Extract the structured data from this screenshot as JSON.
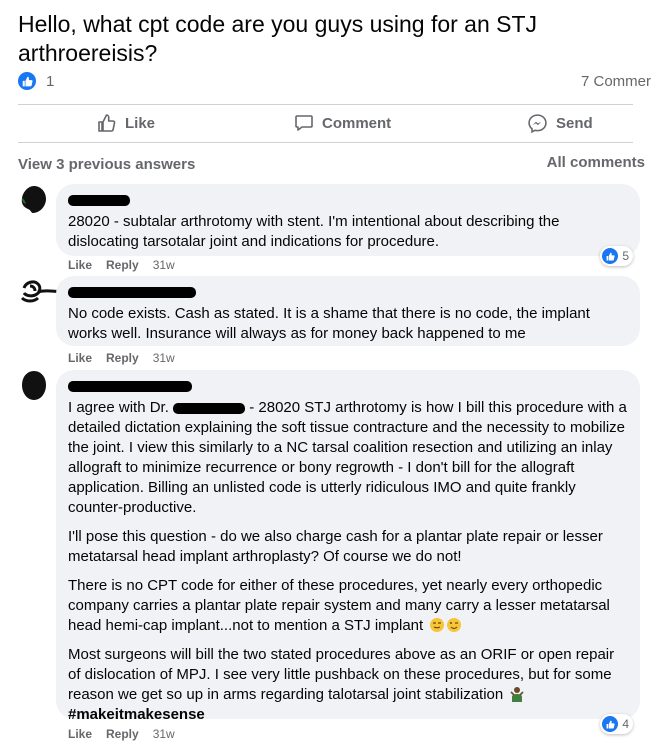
{
  "post": {
    "title": "Hello, what cpt code are you guys using for an STJ arthroereisis?",
    "reaction_count": "1",
    "comment_count": "7 Commer"
  },
  "actions": {
    "like": "Like",
    "comment": "Comment",
    "send": "Send"
  },
  "comments_header": {
    "view_previous": "View 3 previous answers",
    "sort": "All comments"
  },
  "colors": {
    "accent": "#1877f2",
    "bubble": "#f0f2f5",
    "muted": "#65676b"
  },
  "comments": [
    {
      "text": "28020 - subtalar arthrotomy with stent. I'm intentional about describing the dislocating tarsotalar joint and indications for procedure.",
      "like": "Like",
      "reply": "Reply",
      "time": "31w",
      "reactions": "5"
    },
    {
      "text": "No code exists. Cash as stated. It is a shame that there is no code, the implant works well. Insurance will always as for money back happened to me",
      "like": "Like",
      "reply": "Reply",
      "time": "31w"
    },
    {
      "para1_start": "I agree with Dr.",
      "para1_rest": " - 28020 STJ arthrotomy is how I bill this procedure with a detailed dictation explaining the soft tissue contracture and the necessity to mobilize the joint. I view this similarly to a NC tarsal coalition resection and utilizing an inlay allograft to minimize recurrence or bony regrowth - I don't bill for the allograft application. Billing an unlisted code is utterly ridiculous IMO and quite frankly counter-productive.",
      "para2": "I'll pose this question - do we also charge cash for a plantar plate repair or lesser metatarsal head implant arthroplasty? Of course we do not!",
      "para3": "There is no CPT code for either of these procedures, yet nearly every orthopedic company carries a plantar plate repair system and many carry a lesser metatarsal head hemi-cap implant...not to mention a STJ implant",
      "para4": "Most surgeons will bill the two stated procedures above as an ORIF or open repair of dislocation of MPJ. I see very little pushback on these procedures, but for some reason we get so up in arms regarding talotarsal joint stabilization",
      "hashtag": "#makeitmakesense",
      "like": "Like",
      "reply": "Reply",
      "time": "31w",
      "reactions": "4"
    }
  ]
}
